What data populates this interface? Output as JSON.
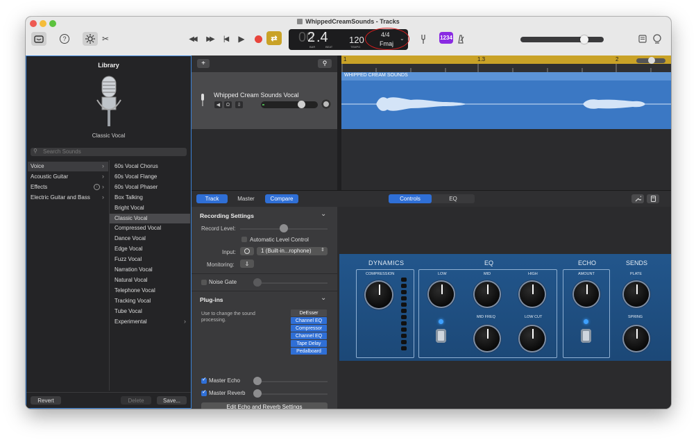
{
  "window": {
    "title": "WhippedCreamSounds - Tracks"
  },
  "toolbar": {
    "help_icon": "?",
    "scissors_icon": "✂",
    "rewind": "◀◀",
    "forward": "▶▶",
    "to_start": "|◀",
    "play": "▶",
    "cycle": "⇄",
    "lcd": {
      "bar": "2",
      "beat": ".4",
      "bar_label": "BAR",
      "beat_label": "BEAT",
      "tempo": "120",
      "tempo_label": "TEMPO",
      "time_sig": "4/4",
      "key": "Fmaj"
    },
    "count_in": "1234",
    "master_volume": 0.8
  },
  "library": {
    "title": "Library",
    "preset_name": "Classic Vocal",
    "search_placeholder": "Search Sounds",
    "categories": [
      "Voice",
      "Acoustic Guitar",
      "Effects",
      "Electric Guitar and Bass"
    ],
    "selected_category": "Voice",
    "presets": [
      "60s Vocal Chorus",
      "60s Vocal Flange",
      "60s Vocal Phaser",
      "Box Talking",
      "Bright Vocal",
      "Classic Vocal",
      "Compressed Vocal",
      "Dance Vocal",
      "Edge Vocal",
      "Fuzz Vocal",
      "Narration Vocal",
      "Natural Vocal",
      "Telephone Vocal",
      "Tracking Vocal",
      "Tube Vocal",
      "Experimental"
    ],
    "selected_preset": "Classic Vocal",
    "revert": "Revert",
    "delete": "Delete",
    "save": "Save..."
  },
  "tracks": {
    "add_icon": "+",
    "ruler": {
      "mark1": "1",
      "mark2": "1.3",
      "mark3": "2"
    },
    "track_name": "Whipped Cream Sounds Vocal",
    "region_name": "WHIPPED CREAM SOUNDS"
  },
  "smart_controls": {
    "tabs": {
      "track": "Track",
      "master": "Master",
      "compare": "Compare"
    },
    "view_tabs": {
      "controls": "Controls",
      "eq": "EQ"
    },
    "recording": {
      "header": "Recording Settings",
      "record_level_label": "Record Level:",
      "record_level": 0.5,
      "auto_level": "Automatic Level Control",
      "input_label": "Input:",
      "input_value": "1 (Built-in...rophone)",
      "monitoring_label": "Monitoring:"
    },
    "noise_gate": "Noise Gate",
    "plugins": {
      "header": "Plug-ins",
      "description": "Use to change the sound processing.",
      "slots": [
        "DeEsser",
        "Channel EQ",
        "Compressor",
        "Channel EQ",
        "Tape Delay",
        "Pedalboard"
      ]
    },
    "master_echo": "Master Echo",
    "master_reverb": "Master Reverb",
    "edit_button": "Edit Echo and Reverb Settings",
    "plugin_panel": {
      "dynamics": "DYNAMICS",
      "compression": "COMPRESSION",
      "eq": "EQ",
      "low": "LOW",
      "mid": "MID",
      "high": "HIGH",
      "mid_freq": "MID FREQ",
      "low_cut": "LOW CUT",
      "echo": "ECHO",
      "amount": "AMOUNT",
      "sends": "SENDS",
      "plate": "PLATE",
      "spring": "SPRING"
    }
  },
  "colors": {
    "accent": "#2f6fd6",
    "record": "#e8453c",
    "cycle": "#c9a227",
    "region": "#3b78c4",
    "plugin_bg": "#1f4f82"
  }
}
